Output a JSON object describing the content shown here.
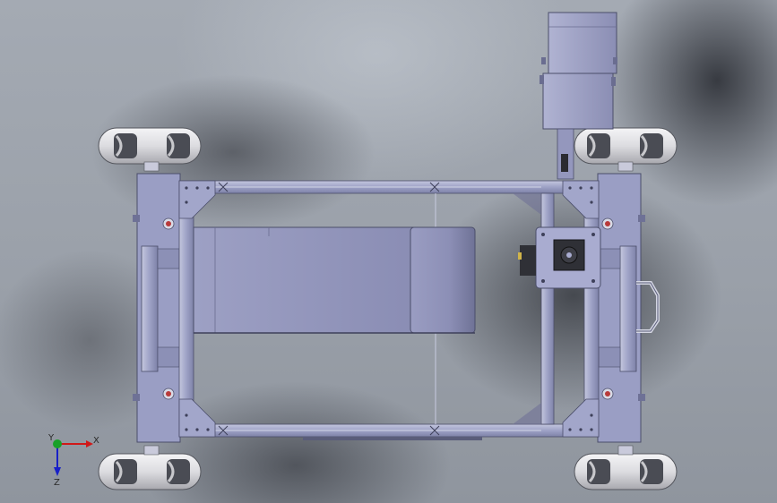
{
  "viewport": {
    "background_top": "#a4aab3",
    "background_bottom": "#8f959e"
  },
  "model": {
    "frame_color": "#9b9fc4",
    "panel_color": "#8e91b8",
    "tire_color": "#e4e4e6",
    "motor_color": "#2b2b2f"
  },
  "triad": {
    "x_label": "X",
    "y_label": "Y",
    "z_label": "Z",
    "x_color": "#d01818",
    "y_color": "#18a028",
    "z_color": "#1820c8"
  }
}
